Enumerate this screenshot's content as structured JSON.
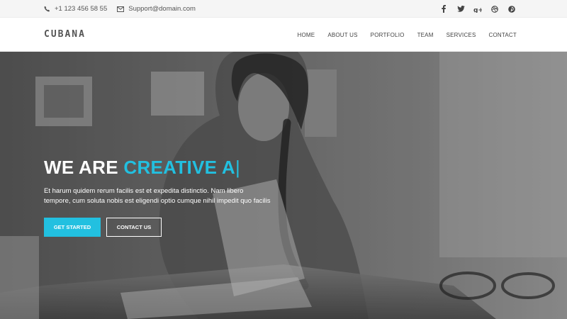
{
  "topbar": {
    "phone": "+1 123 456 58 55",
    "email": "Support@domain.com",
    "social_icons": [
      "facebook-icon",
      "twitter-icon",
      "google-plus-icon",
      "dribbble-icon",
      "pinterest-icon"
    ]
  },
  "navbar": {
    "logo": "CUBANA",
    "menu": [
      "HOME",
      "ABOUT US",
      "PORTFOLIO",
      "TEAM",
      "SERVICES",
      "CONTACT"
    ]
  },
  "hero": {
    "headline_prefix": "WE ARE",
    "headline_accent": "CREATIVE A",
    "cursor": "|",
    "description": "Et harum quidem rerum facilis est et expedita distinctio. Nam libero tempore, cum soluta nobis est eligendi optio cumque nihil impedit quo facilis",
    "primary_button": "GET STARTED",
    "secondary_button": "CONTACT US"
  },
  "colors": {
    "accent": "#22c0e0",
    "topbar_bg": "#f5f5f5"
  }
}
